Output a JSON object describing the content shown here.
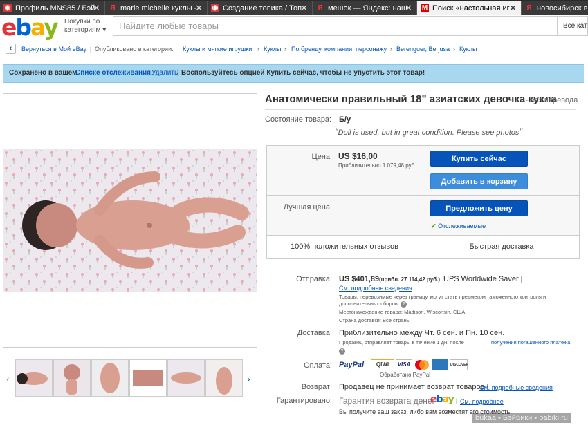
{
  "browser": {
    "tabs": [
      {
        "label": "Профиль MNS85 / Бэй",
        "icon": "babiki-favicon"
      },
      {
        "label": "marie michelle куклы -",
        "icon": "yandex-favicon"
      },
      {
        "label": "Создание топика / Топ",
        "icon": "babiki-favicon"
      },
      {
        "label": "мешок — Яндекс: наш",
        "icon": "yandex-favicon"
      },
      {
        "label": "Поиск «настольная иг",
        "icon": "mail-favicon"
      },
      {
        "label": "новосибирск вр",
        "icon": "yandex-favicon"
      }
    ]
  },
  "header": {
    "logo_letters": [
      "e",
      "b",
      "a",
      "y"
    ],
    "logo_colors": [
      "#e53238",
      "#0064d2",
      "#f5af02",
      "#86b817"
    ],
    "category_line1": "Покупки по",
    "category_line2": "категориям",
    "search_placeholder": "Найдите любые товары",
    "search_category": "Все кат"
  },
  "breadcrumb": {
    "back": "Вернуться в Мой eBay",
    "published": "Опубликовано в категории:",
    "items": [
      "Куклы и мягкие игрушки",
      "Куклы",
      "По бренду, компании, персонажу",
      "Berenguer, Berjusa",
      "Куклы"
    ]
  },
  "banner": {
    "saved": "Сохранено в вашем",
    "watch_link": "Списке отслеживания",
    "remove": "Удалить",
    "rest": "Воспользуйтесь опцией Купить сейчас, чтобы не упустить этот товар!"
  },
  "item": {
    "title": "Анатомически правильный 18\" азиатских девочка кукла",
    "title_suffix": "- без перевода",
    "condition_label": "Состояние товара:",
    "condition_value": "Б/у",
    "condition_note": "Doll is used, but in great condition. Please see photos",
    "price_label": "Цена:",
    "price": "US $16,00",
    "price_approx": "Приблизительно 1 079,48 руб.",
    "buy_now": "Купить сейчас",
    "add_to_cart": "Добавить в корзину",
    "best_offer_label": "Лучшая цена:",
    "make_offer": "Предложить цену",
    "watching": "Отслеживаемые",
    "positive_feedback": "100% положительных отзывов",
    "fast_delivery": "Быстрая доставка"
  },
  "shipping": {
    "label": "Отправка:",
    "price": "US $401,89",
    "approx": "(прибл. 27 114,42 руб.)",
    "service": "UPS Worldwide Saver |",
    "details_link": "См. подробные сведения",
    "customs_note_1": "Товары, перевозимые через границу, могут стать предметом таможенного контроля и",
    "customs_note_2": "дополнительных сборов.",
    "location": "Местонахождение товара: Madison, Wisconsin, США",
    "ships_to": "Страна доставки: Все страны"
  },
  "delivery": {
    "label": "Доставка:",
    "estimate": "Приблизительно между Чт. 6 сен. и Пн. 10 сен.",
    "note": "Продавец отправляет товары в течение 1 дн. после",
    "note_link": "получения погашенного платежа"
  },
  "payment": {
    "label": "Оплата:",
    "methods": [
      "PayPal",
      "QIWI",
      "VISA",
      "MasterCard",
      "AmEx",
      "DISCOVER"
    ],
    "processed": "Обработано PayPal"
  },
  "returns": {
    "label": "Возврат:",
    "text": "Продавец не принимает возврат товаров |",
    "link": "См. подробные сведения"
  },
  "guarantee": {
    "label": "Гарантировано:",
    "text": "Гарантия возврата денег",
    "link": "См. подробнее",
    "note": "Вы получите ваш заказ, либо вам возместят его стоимость."
  },
  "thumbnails_count": 6,
  "watermark": "bukaa • Бэйбики • babiki.ru"
}
